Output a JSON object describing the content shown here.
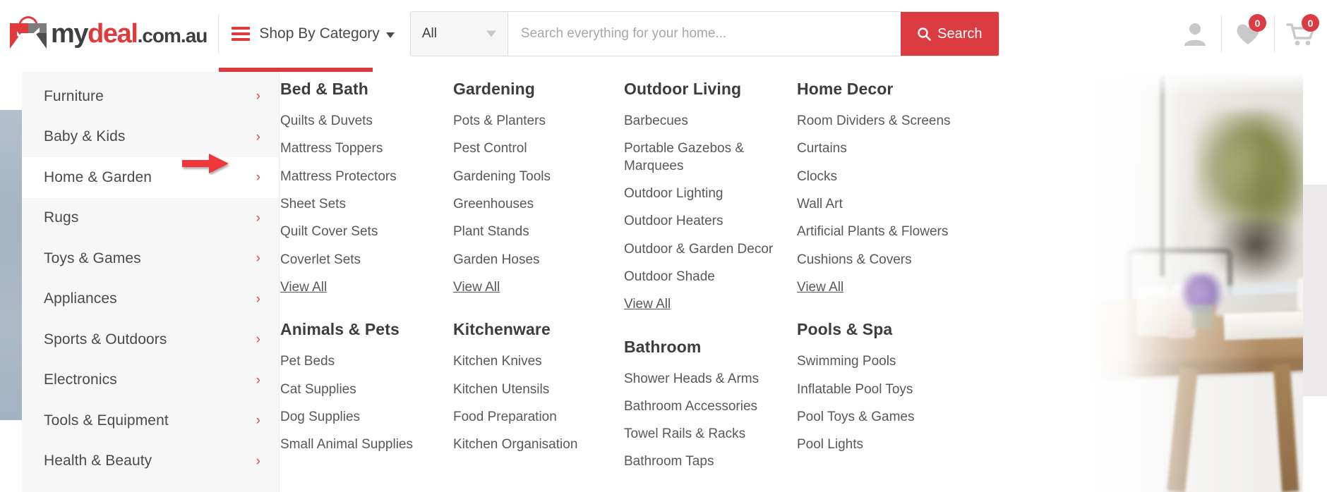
{
  "header": {
    "logo": {
      "part1": "my",
      "part2": "deal",
      "part3": ".com.au",
      "icon": "shopping-bag-tick-logo"
    },
    "shop_by_category": "Shop By Category",
    "search": {
      "category_selected": "All",
      "placeholder": "Search everything for your home...",
      "value": "",
      "button_label": "Search"
    },
    "account_icon": "user-icon",
    "wishlist": {
      "icon": "heart-icon",
      "count": "0"
    },
    "cart": {
      "icon": "shopping-cart-icon",
      "count": "0"
    },
    "accent_color": "#da3c41"
  },
  "sidebar": {
    "items": [
      {
        "label": "Furniture",
        "chevron": "›",
        "active": false
      },
      {
        "label": "Baby & Kids",
        "chevron": "›",
        "active": false
      },
      {
        "label": "Home & Garden",
        "chevron": "›",
        "active": true
      },
      {
        "label": "Rugs",
        "chevron": "›",
        "active": false
      },
      {
        "label": "Toys & Games",
        "chevron": "›",
        "active": false
      },
      {
        "label": "Appliances",
        "chevron": "›",
        "active": false
      },
      {
        "label": "Sports & Outdoors",
        "chevron": "›",
        "active": false
      },
      {
        "label": "Electronics",
        "chevron": "›",
        "active": false
      },
      {
        "label": "Tools & Equipment",
        "chevron": "›",
        "active": false
      },
      {
        "label": "Health & Beauty",
        "chevron": "›",
        "active": false
      }
    ]
  },
  "megamenu": {
    "columns": [
      {
        "groups": [
          {
            "title": "Bed & Bath",
            "links": [
              "Quilts & Duvets",
              "Mattress Toppers",
              "Mattress Protectors",
              "Sheet Sets",
              "Quilt Cover Sets",
              "Coverlet Sets"
            ],
            "view_all": "View All"
          },
          {
            "title": "Animals & Pets",
            "links": [
              "Pet Beds",
              "Cat Supplies",
              "Dog Supplies",
              "Small Animal Supplies"
            ],
            "view_all": ""
          }
        ]
      },
      {
        "groups": [
          {
            "title": "Gardening",
            "links": [
              "Pots & Planters",
              "Pest Control",
              "Gardening Tools",
              "Greenhouses",
              "Plant Stands",
              "Garden Hoses"
            ],
            "view_all": "View All"
          },
          {
            "title": "Kitchenware",
            "links": [
              "Kitchen Knives",
              "Kitchen Utensils",
              "Food Preparation",
              "Kitchen Organisation"
            ],
            "view_all": ""
          }
        ]
      },
      {
        "groups": [
          {
            "title": "Outdoor Living",
            "links": [
              "Barbecues",
              "Portable Gazebos & Marquees",
              "Outdoor Lighting",
              "Outdoor Heaters",
              "Outdoor & Garden Decor",
              "Outdoor Shade"
            ],
            "view_all": "View All"
          },
          {
            "title": "Bathroom",
            "links": [
              "Shower Heads & Arms",
              "Bathroom Accessories",
              "Towel Rails & Racks",
              "Bathroom Taps"
            ],
            "view_all": ""
          }
        ]
      },
      {
        "groups": [
          {
            "title": "Home Decor",
            "links": [
              "Room Dividers & Screens",
              "Curtains",
              "Clocks",
              "Wall Art",
              "Artificial Plants & Flowers",
              "Cushions & Covers"
            ],
            "view_all": "View All"
          },
          {
            "title": "Pools & Spa",
            "links": [
              "Swimming Pools",
              "Inflatable Pool Toys",
              "Pool Toys & Games",
              "Pool Lights"
            ],
            "view_all": ""
          }
        ]
      }
    ]
  },
  "promo": {
    "alt": "outdoor dining table lifestyle photo"
  },
  "annotation": {
    "arrow": "red-right-arrow",
    "color": "#f0353b",
    "points_at": "Home & Garden"
  }
}
